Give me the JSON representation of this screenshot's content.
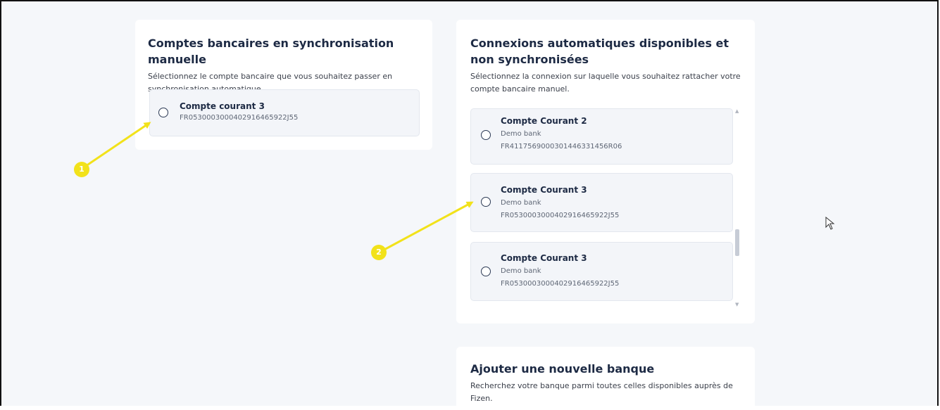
{
  "manual_card": {
    "title": "Comptes bancaires en synchronisation manuelle",
    "subtitle": "Sélectionnez le compte bancaire que vous souhaitez passer en synchronisation automatique.",
    "account": {
      "name": "Compte courant 3",
      "iban": "FR05300030004029164659​22J55"
    }
  },
  "auto_card": {
    "title": "Connexions automatiques disponibles et non synchronisées",
    "subtitle": "Sélectionnez la connexion sur laquelle vous souhaitez rattacher votre compte bancaire manuel.",
    "connections": [
      {
        "name": "Compte Courant 2",
        "bank": "Demo bank",
        "iban": "FR4117569000301446331456R06"
      },
      {
        "name": "Compte Courant 3",
        "bank": "Demo bank",
        "iban": "FR05300030004029164659​22J55"
      },
      {
        "name": "Compte Courant 3",
        "bank": "Demo bank",
        "iban": "FR05300030004029164659​22J55"
      }
    ]
  },
  "add_bank_card": {
    "title": "Ajouter une nouvelle banque",
    "subtitle": "Recherchez votre banque parmi toutes celles disponibles auprès de Fizen."
  },
  "annotations": {
    "badge_1": "1",
    "badge_2": "2",
    "color": "#f2e21a"
  }
}
